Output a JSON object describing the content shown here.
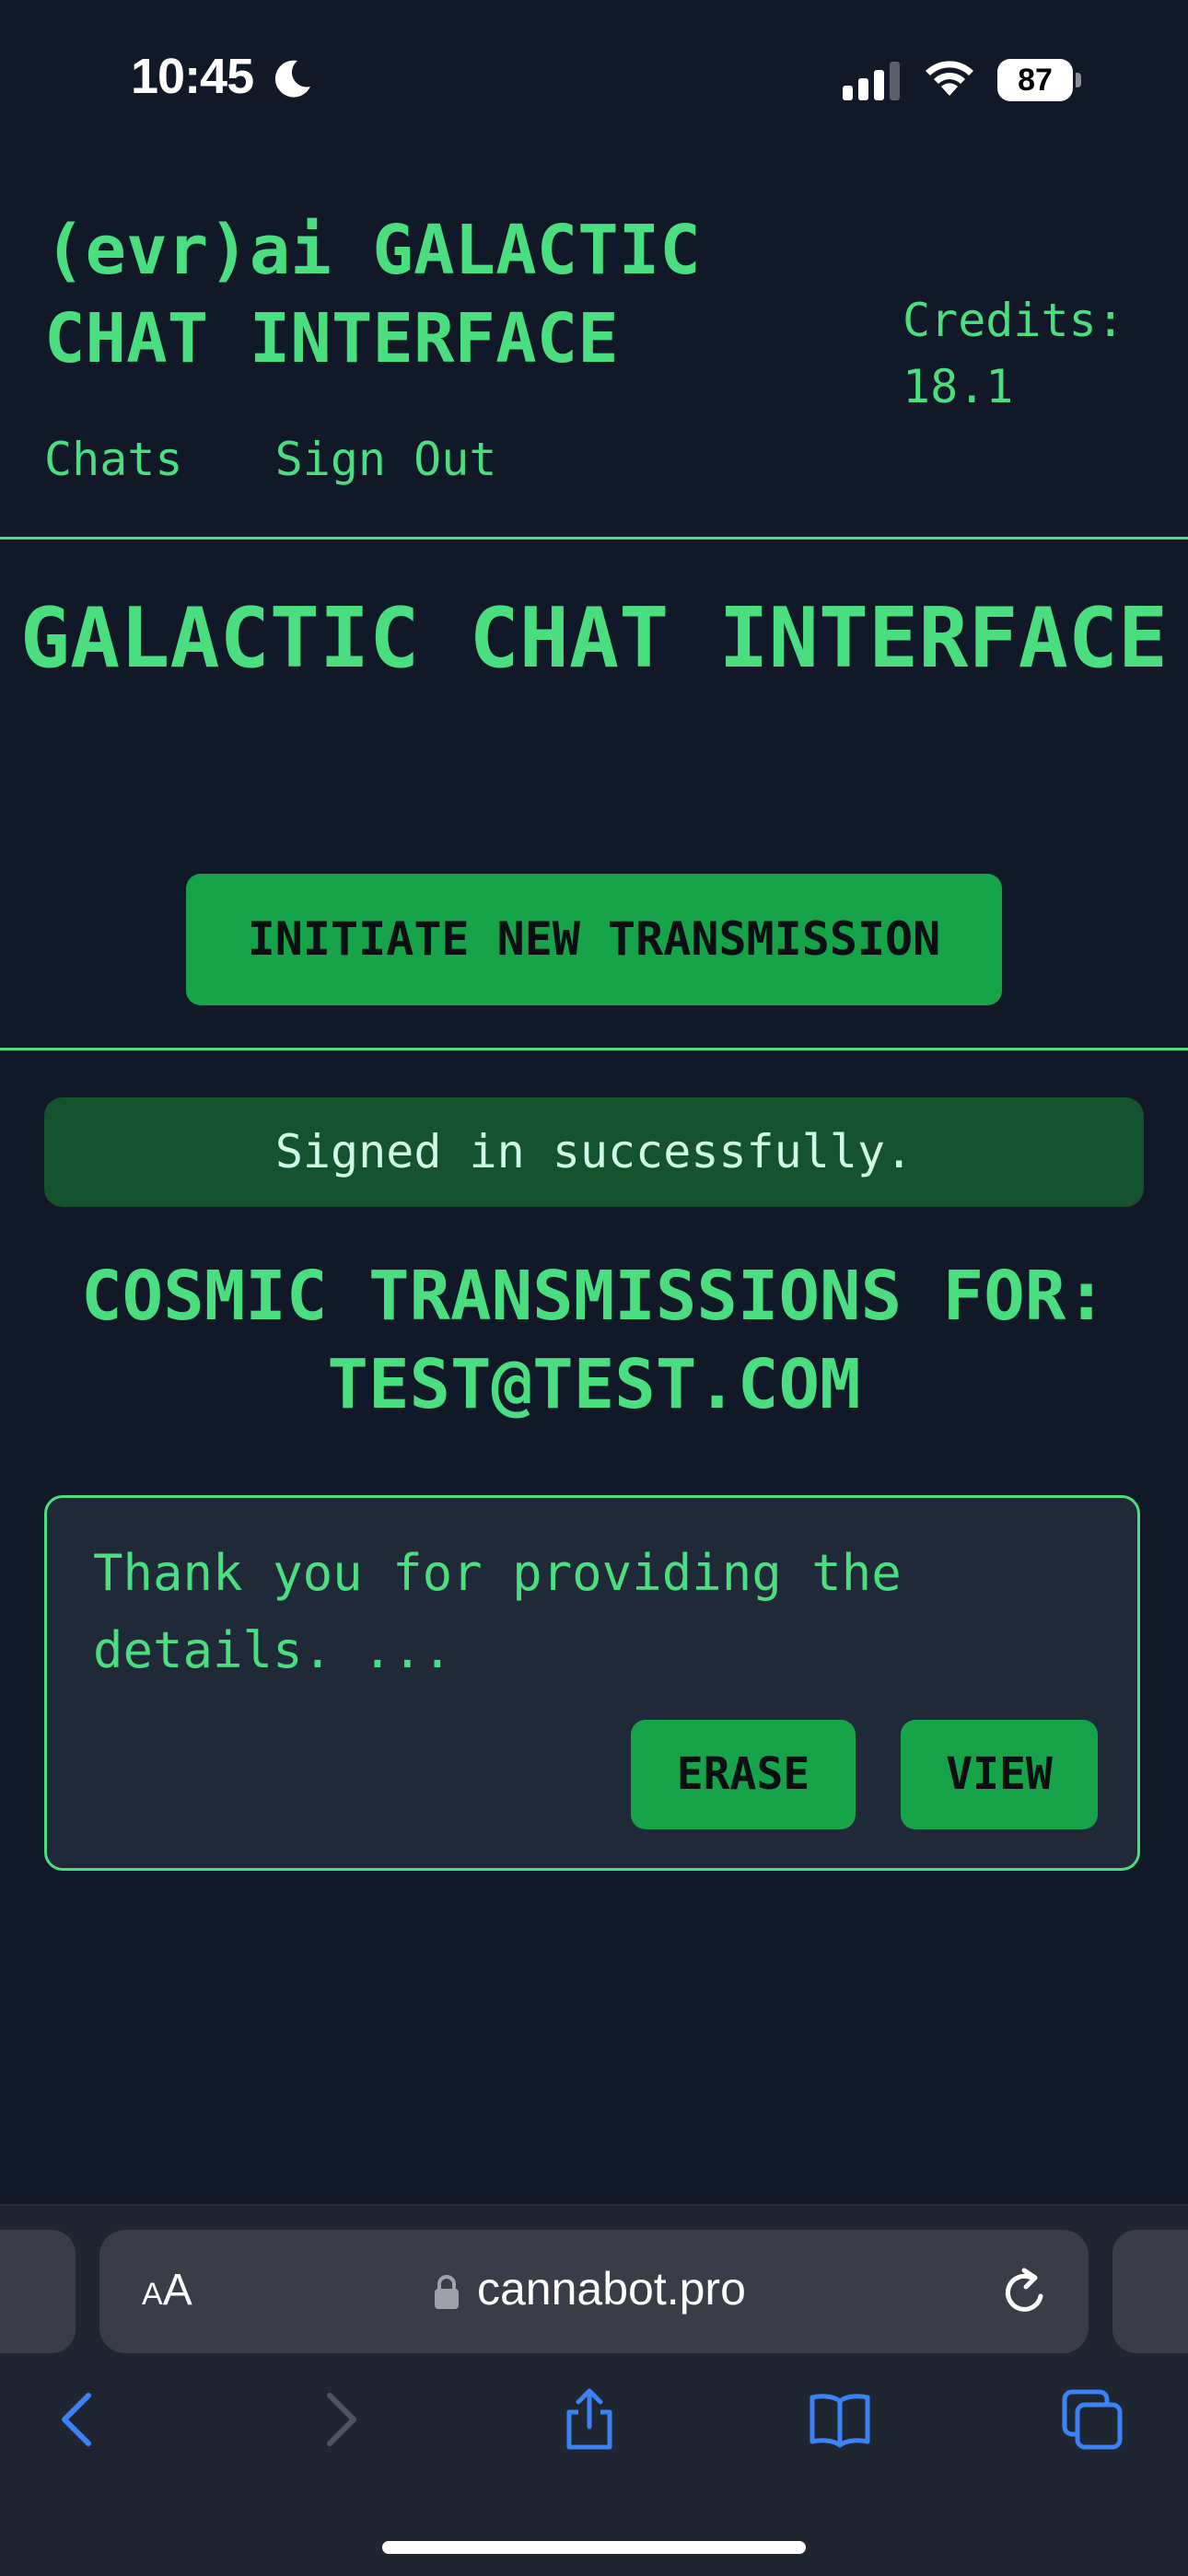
{
  "status_bar": {
    "time": "10:45",
    "battery": "87"
  },
  "header": {
    "app_title": "(evr)ai GALACTIC CHAT INTERFACE",
    "credits": "Credits: 18.1",
    "nav": [
      "Chats",
      "Sign Out"
    ]
  },
  "hero": {
    "title": "GALACTIC CHAT INTERFACE",
    "new_button": "INITIATE NEW TRANSMISSION"
  },
  "flash": "Signed in successfully.",
  "transmissions": {
    "title": "COSMIC TRANSMISSIONS FOR: TEST@TEST.COM",
    "items": [
      {
        "preview": "Thank you for providing the details. ...",
        "erase": "ERASE",
        "view": "VIEW"
      }
    ]
  },
  "browser": {
    "text_size": "AA",
    "url": "cannabot.pro"
  },
  "colors": {
    "accent": "#4ade80",
    "button": "#16a34a",
    "background": "#111827",
    "card": "#1f2937",
    "flash_bg": "#14532d"
  }
}
